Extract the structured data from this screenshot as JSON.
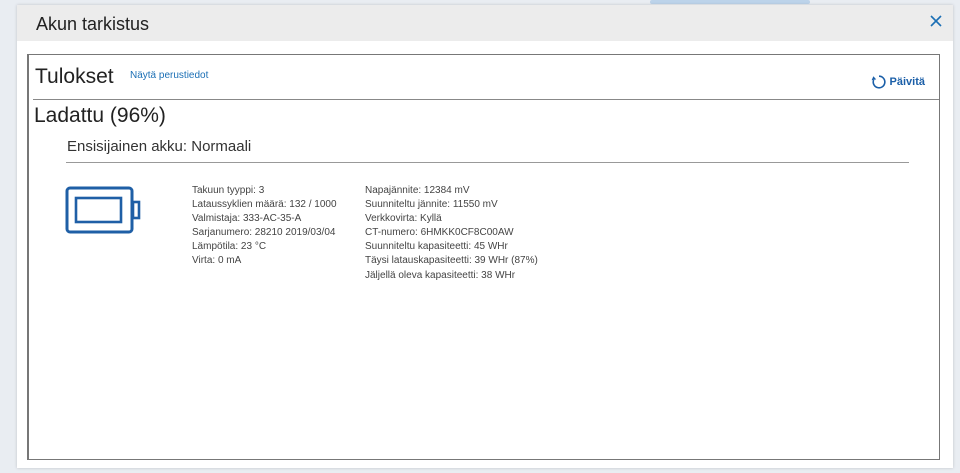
{
  "dialog": {
    "title": "Akun tarkistus"
  },
  "results": {
    "title": "Tulokset",
    "basic_info_link": "Näytä perustiedot",
    "refresh_label": "Päivitä"
  },
  "status": {
    "charge": "Ladattu (96%)",
    "primary_battery": "Ensisijainen akku: Normaali"
  },
  "details_left": [
    "Takuun tyyppi: 3",
    "Lataussyklien määrä: 132 / 1000",
    "Valmistaja: 333-AC-35-A",
    "Sarjanumero: 28210 2019/03/04",
    "Lämpötila: 23 °C",
    "Virta: 0 mA"
  ],
  "details_right": [
    "Napajännite: 12384 mV",
    "Suunniteltu jännite: 11550 mV",
    "Verkkovirta: Kyllä",
    "CT-numero: 6HMKK0CF8C00AW",
    "Suunniteltu kapasiteetti: 45 WHr",
    "Täysi latauskapasiteetti: 39 WHr (87%)",
    "Jäljellä oleva kapasiteetti: 38 WHr"
  ],
  "icons": {
    "close": "close-icon",
    "refresh": "refresh-icon",
    "battery": "battery-icon"
  },
  "colors": {
    "accent": "#1b6fb5",
    "battery": "#1f5fa6",
    "titlebar": "#ececec"
  }
}
